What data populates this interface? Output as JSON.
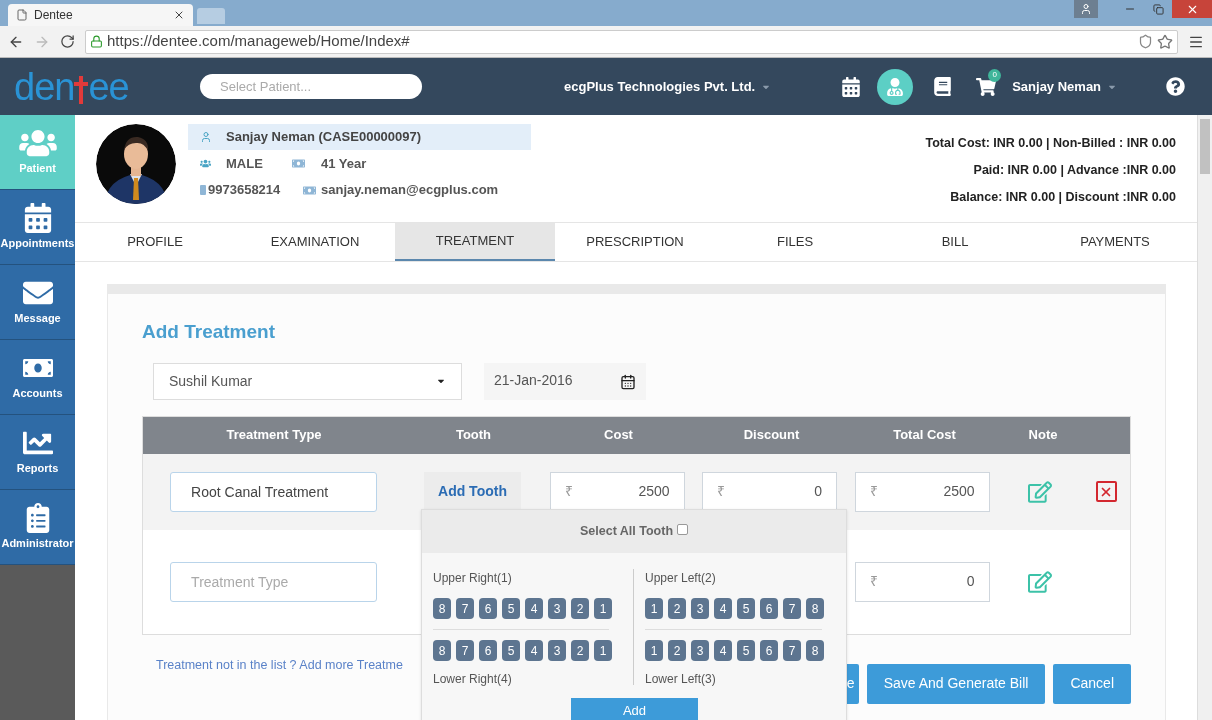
{
  "browser": {
    "tab_title": "Dentee",
    "url": "https://dentee.com/manageweb/Home/Index#"
  },
  "header": {
    "logo_start": "den",
    "logo_end": "ee",
    "search_placeholder": "Select Patient...",
    "company": "ecgPlus Technologies Pvt. Ltd.",
    "cart_count": "0",
    "user": "Sanjay Neman"
  },
  "sidebar": [
    {
      "kind": "patient",
      "label": "Patient",
      "selected": true
    },
    {
      "kind": "calendar",
      "label": "Appointments",
      "selected": false
    },
    {
      "kind": "message",
      "label": "Message",
      "selected": false
    },
    {
      "kind": "money",
      "label": "Accounts",
      "selected": false
    },
    {
      "kind": "chart",
      "label": "Reports",
      "selected": false
    },
    {
      "kind": "clipboard",
      "label": "Administrator",
      "selected": false
    }
  ],
  "patient": {
    "name": "Sanjay Neman (CASE00000097)",
    "gender": "MALE",
    "age": "41 Year",
    "phone": "9973658214",
    "email": "sanjay.neman@ecgplus.com",
    "summary": [
      "Total Cost: INR 0.00 | Non-Billed : INR 0.00",
      "Paid: INR 0.00 | Advance :INR 0.00",
      "Balance: INR 0.00 | Discount :INR 0.00"
    ]
  },
  "tabs": [
    {
      "label": "PROFILE",
      "selected": false
    },
    {
      "label": "EXAMINATION",
      "selected": false
    },
    {
      "label": "TREATMENT",
      "selected": true
    },
    {
      "label": "PRESCRIPTION",
      "selected": false
    },
    {
      "label": "FILES",
      "selected": false
    },
    {
      "label": "BILL",
      "selected": false
    },
    {
      "label": "PAYMENTS",
      "selected": false
    }
  ],
  "form": {
    "title": "Add Treatment",
    "doctor": "Sushil Kumar",
    "date": "21-Jan-2016"
  },
  "table": {
    "columns": [
      "Treatment Type",
      "Tooth",
      "Cost",
      "Discount",
      "Total Cost",
      "Note"
    ],
    "rows": [
      {
        "treatment": {
          "value": "Root Canal Treatment"
        },
        "tooth_button": "Add Tooth",
        "cost": {
          "symbol": "₹",
          "value": "2500"
        },
        "discount": {
          "symbol": "₹",
          "value": "0"
        },
        "total": {
          "symbol": "₹",
          "value": "2500"
        },
        "deletable": true
      },
      {
        "treatment": {
          "placeholder": "Treatment Type"
        },
        "total": {
          "symbol": "₹",
          "value": "0"
        },
        "deletable": false
      }
    ]
  },
  "tooth_picker": {
    "select_all": "Select All Tooth",
    "checked": false,
    "columns": [
      {
        "top_label": "Upper Right(1)",
        "upper": [
          "8",
          "7",
          "6",
          "5",
          "4",
          "3",
          "2",
          "1"
        ],
        "lower": [
          "8",
          "7",
          "6",
          "5",
          "4",
          "3",
          "2",
          "1"
        ],
        "bottom_label": "Lower Right(4)"
      },
      {
        "top_label": "Upper Left(2)",
        "upper": [
          "1",
          "2",
          "3",
          "4",
          "5",
          "6",
          "7",
          "8"
        ],
        "lower": [
          "1",
          "2",
          "3",
          "4",
          "5",
          "6",
          "7",
          "8"
        ],
        "bottom_label": "Lower Left(3)"
      }
    ],
    "add_button": "Add"
  },
  "add_more_link": "Treatment not in the list ? Add more Treatme",
  "buttons": [
    "e",
    "Save And Generate Bill",
    "Cancel"
  ]
}
